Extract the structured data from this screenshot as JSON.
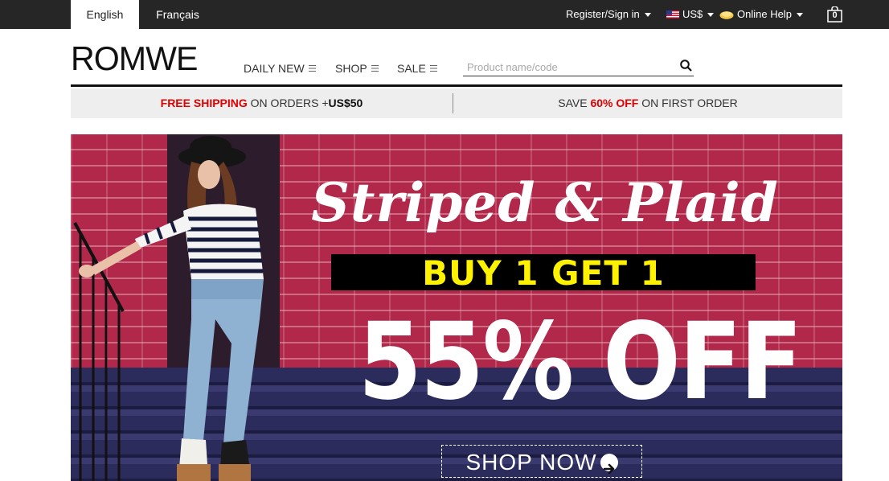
{
  "topbar": {
    "languages": [
      "English",
      "Français"
    ],
    "register_label": "Register/Sign in",
    "currency_label": "US$",
    "help_label": "Online Help",
    "cart_count": "0"
  },
  "header": {
    "logo": "ROMWE",
    "nav": [
      "DAILY NEW",
      "SHOP",
      "SALE"
    ],
    "search_placeholder": "Product name/code"
  },
  "promo": {
    "left": {
      "highlight": "FREE SHIPPING",
      "text": " ON ORDERS +",
      "amount": "US$50"
    },
    "right": {
      "prefix": "SAVE ",
      "highlight": "60% OFF",
      "suffix": " ON FIRST ORDER"
    }
  },
  "banner": {
    "headline": "Striped & Plaid",
    "offer": "BUY 1 GET 1",
    "discount": "55% OFF",
    "cta": "SHOP NOW"
  },
  "colors": {
    "topbar": "#262626",
    "accent_red": "#e00000",
    "offer_yellow": "#fff200",
    "wall": "#b2284a"
  },
  "icons": [
    "search-icon",
    "cart-icon",
    "flag-us-icon",
    "help-icon",
    "arrow-right-icon",
    "menu-lines-icon",
    "chevron-down-icon"
  ]
}
